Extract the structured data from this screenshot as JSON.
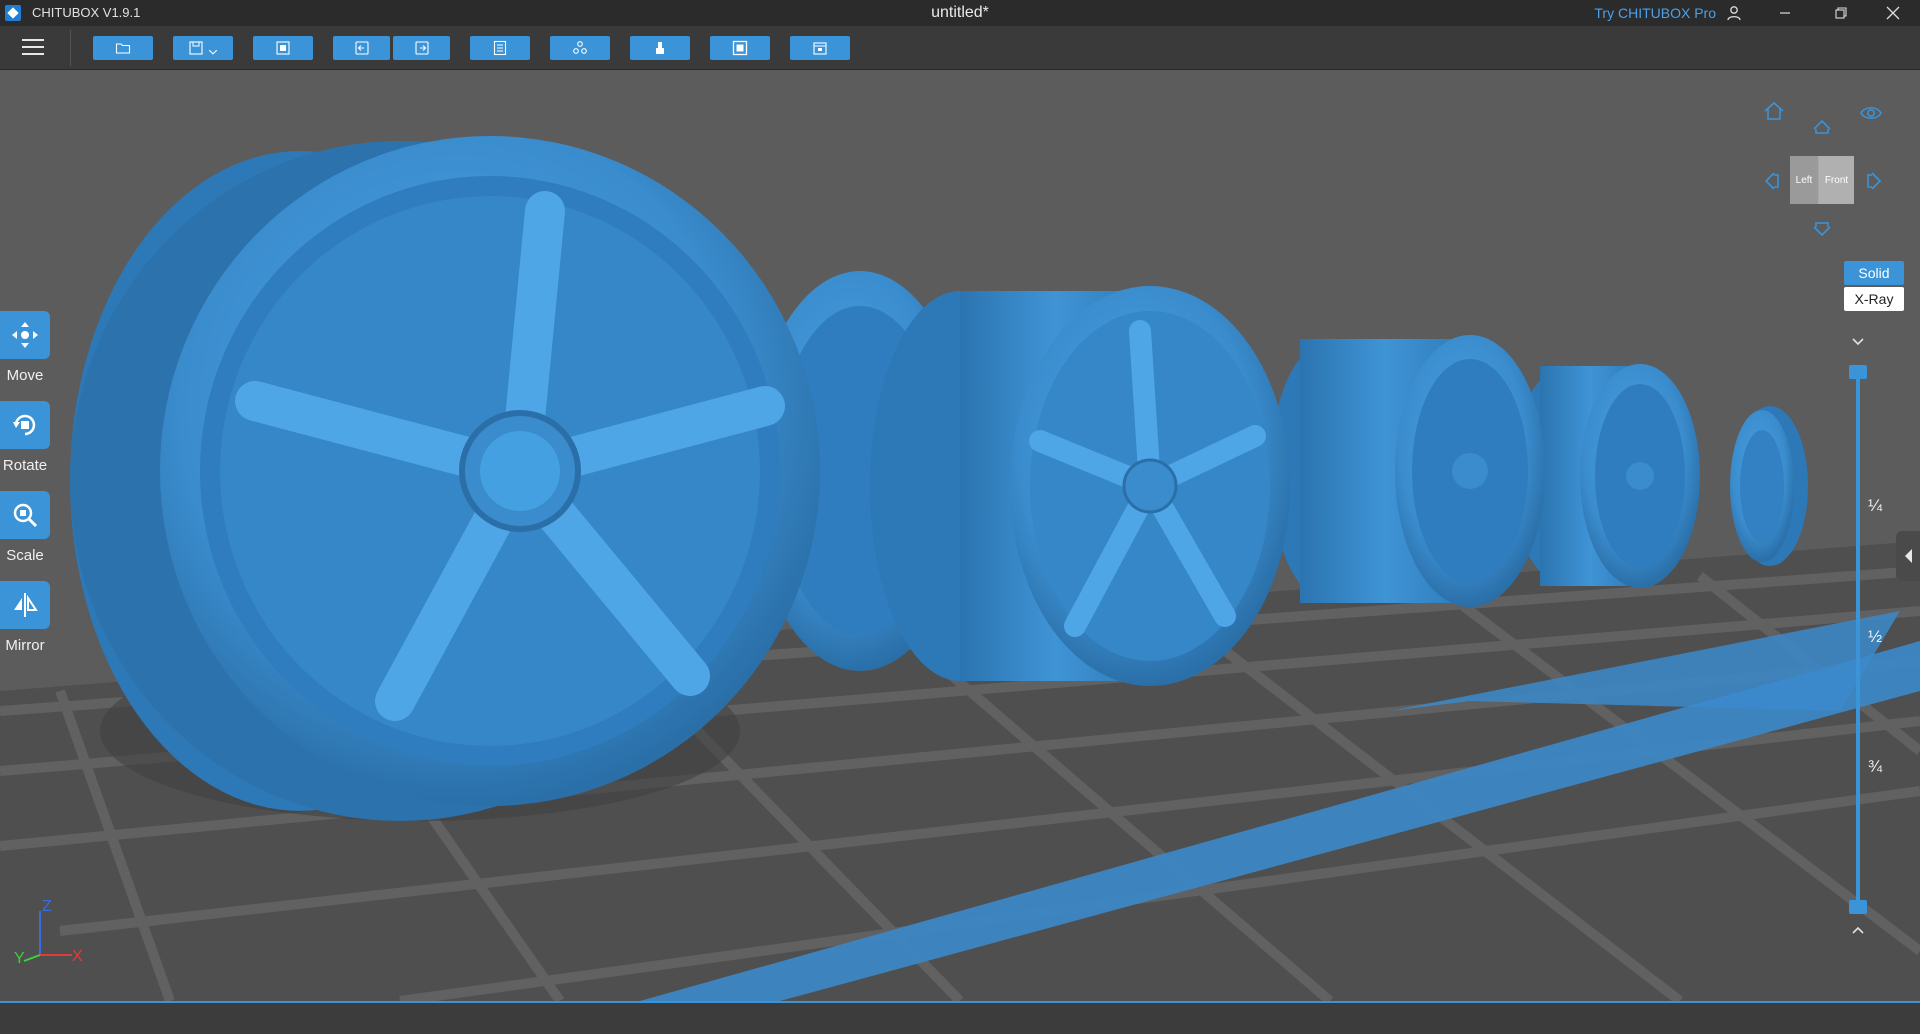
{
  "titlebar": {
    "app_name": "CHITUBOX V1.9.1",
    "doc_title": "untitled*",
    "try_pro": "Try CHITUBOX Pro"
  },
  "toolbar": {
    "buttons": [
      {
        "name": "open-file",
        "icon": "folder-icon"
      },
      {
        "name": "save",
        "icon": "save-icon",
        "has_dropdown": true
      },
      {
        "name": "select-all",
        "icon": "select-icon"
      },
      {
        "name": "undo",
        "icon": "undo-icon"
      },
      {
        "name": "redo",
        "icon": "redo-icon"
      },
      {
        "name": "model-list",
        "icon": "list-icon"
      },
      {
        "name": "auto-layout",
        "icon": "layout-icon"
      },
      {
        "name": "supports",
        "icon": "support-icon"
      },
      {
        "name": "hollow",
        "icon": "hollow-icon"
      },
      {
        "name": "dig-hole",
        "icon": "hole-icon"
      }
    ]
  },
  "tools": [
    {
      "label": "Move",
      "icon": "move-icon"
    },
    {
      "label": "Rotate",
      "icon": "rotate-icon"
    },
    {
      "label": "Scale",
      "icon": "scale-icon"
    },
    {
      "label": "Mirror",
      "icon": "mirror-icon"
    }
  ],
  "viewcube": {
    "left": "Left",
    "front": "Front"
  },
  "view_mode": {
    "solid": "Solid",
    "xray": "X-Ray",
    "active": "Solid"
  },
  "layer_slider": {
    "ticks": [
      "¼",
      "½",
      "¾"
    ]
  },
  "axes": {
    "x": "X",
    "y": "Y",
    "z": "Z"
  },
  "colors": {
    "accent": "#3b93d8",
    "model": "#3d8fd0",
    "platform": "#4e4e4e",
    "titlebar": "#2b2b2b",
    "axis_x": "#e23b3b",
    "axis_y": "#3bd23b",
    "axis_z": "#3b6de2"
  }
}
